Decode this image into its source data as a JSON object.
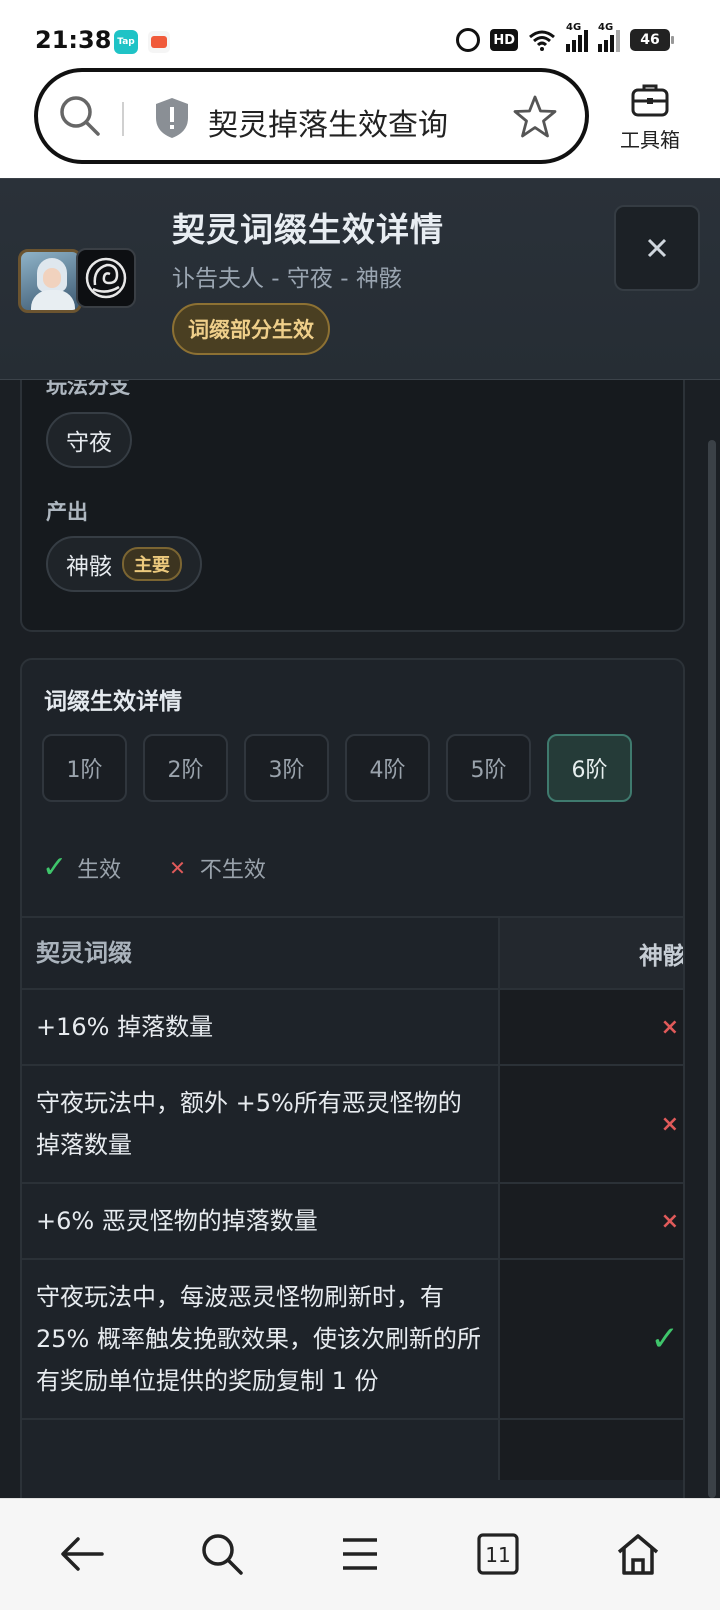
{
  "status_bar": {
    "time": "21:38",
    "app1_label": "Tap",
    "hd_label": "HD",
    "signal1": "4G",
    "signal2": "4G",
    "battery": "46"
  },
  "browser": {
    "url_text": "契灵掉落生效查询",
    "toolbox_label": "工具箱",
    "tab_count": "11"
  },
  "header": {
    "title": "契灵词缀生效详情",
    "subtitle": "讣告夫人 - 守夜 - 神骸",
    "badge": "词缀部分生效",
    "close_icon": "close-icon"
  },
  "card1": {
    "section1_label": "玩法分支",
    "section1_chip": "守夜",
    "section2_label": "产出",
    "section2_chip": "神骸",
    "section2_tag": "主要"
  },
  "card2": {
    "title": "词缀生效详情",
    "tabs": [
      "1阶",
      "2阶",
      "3阶",
      "4阶",
      "5阶",
      "6阶"
    ],
    "active_tab": "6阶",
    "legend_ok": "生效",
    "legend_no": "不生效",
    "table": {
      "header": [
        "契灵词缀",
        "神骸"
      ],
      "rows": [
        {
          "text": "+16% 掉落数量",
          "status": "×"
        },
        {
          "text": "守夜玩法中，额外 +5%所有恶灵怪物的掉落数量",
          "status": "×"
        },
        {
          "text": "+6% 恶灵怪物的掉落数量",
          "status": "×"
        },
        {
          "text": "守夜玩法中，每波恶灵怪物刷新时，有 25% 概率触发挽歌效果，使该次刷新的所有奖励单位提供的奖励复制 1 份",
          "status": "✓"
        }
      ]
    }
  },
  "colors": {
    "ok": "#3fc56b",
    "no": "#e05a5a",
    "accent_gold": "#efcf8a",
    "active_tab": "#253b38"
  }
}
